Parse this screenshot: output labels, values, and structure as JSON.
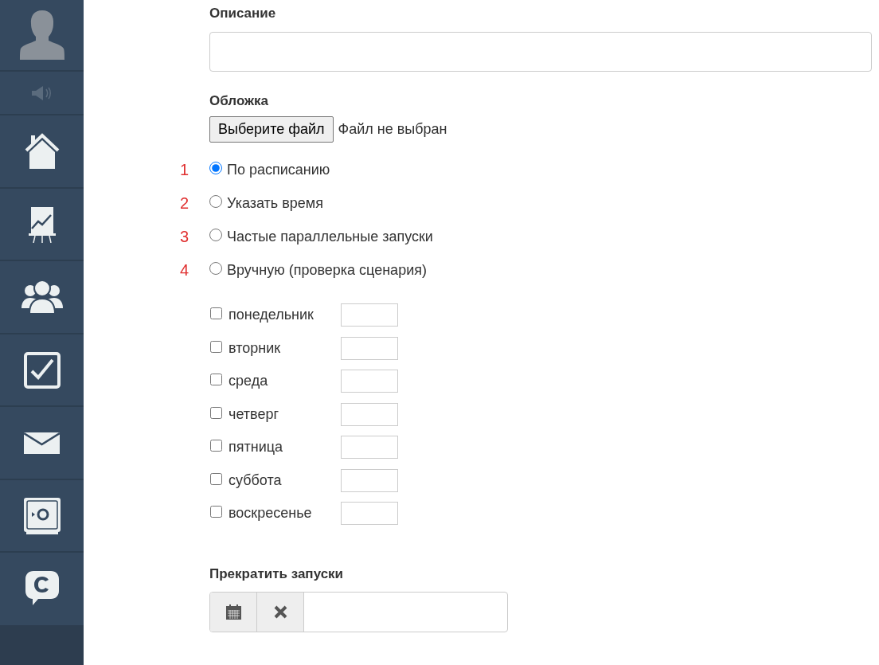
{
  "description": {
    "label": "Описание"
  },
  "cover": {
    "label": "Обложка",
    "button": "Выберите файл",
    "status": "Файл не выбран"
  },
  "schedule_modes": [
    {
      "number": "1",
      "label": "По расписанию",
      "selected": true
    },
    {
      "number": "2",
      "label": "Указать время",
      "selected": false
    },
    {
      "number": "3",
      "label": "Частые параллельные запуски",
      "selected": false
    },
    {
      "number": "4",
      "label": "Вручную (проверка сценария)",
      "selected": false
    }
  ],
  "weekdays": [
    {
      "label": "понедельник",
      "checked": false
    },
    {
      "label": "вторник",
      "checked": false
    },
    {
      "label": "среда",
      "checked": false
    },
    {
      "label": "четверг",
      "checked": false
    },
    {
      "label": "пятница",
      "checked": false
    },
    {
      "label": "суббота",
      "checked": false
    },
    {
      "label": "воскресенье",
      "checked": false
    }
  ],
  "stop": {
    "label": "Прекратить запуски"
  }
}
